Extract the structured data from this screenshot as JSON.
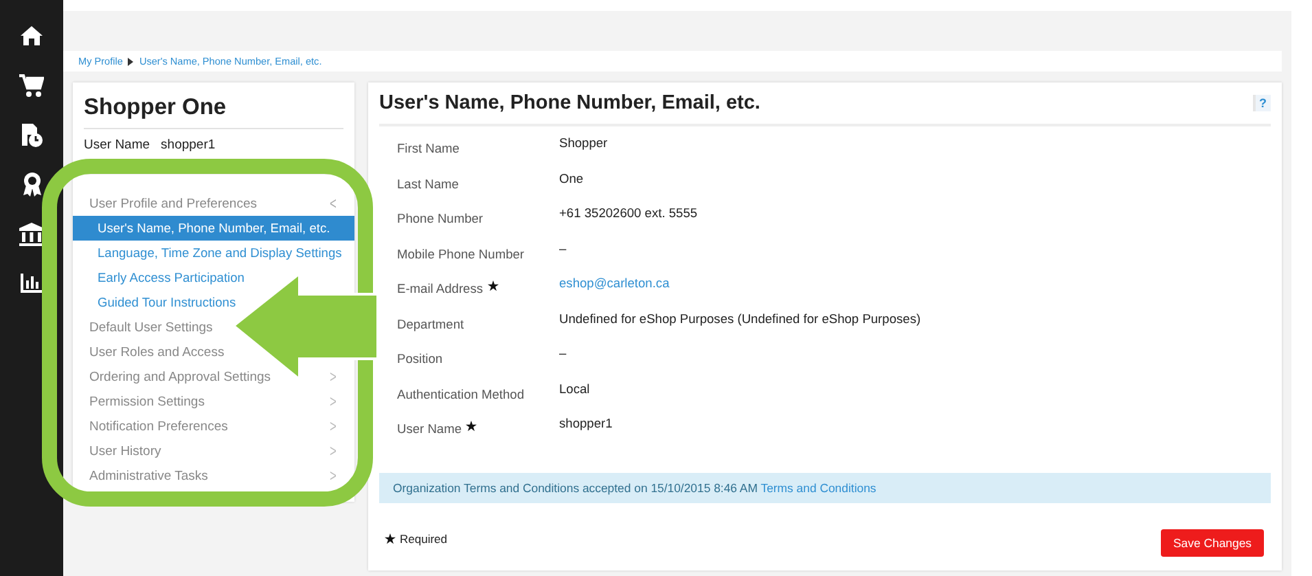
{
  "nav_rail": {
    "items": [
      {
        "kind": "home"
      },
      {
        "kind": "cart"
      },
      {
        "kind": "orders"
      },
      {
        "kind": "award"
      },
      {
        "kind": "bank"
      },
      {
        "kind": "chart"
      }
    ]
  },
  "breadcrumb": [
    {
      "label": "My Profile"
    },
    {
      "label": "User's Name, Phone Number, Email, etc."
    }
  ],
  "profile": {
    "name": "Shopper One",
    "user_name_label": "User Name",
    "user_name": "shopper1"
  },
  "menu": [
    {
      "label": "User Profile and Preferences",
      "kind": "group",
      "expanded": true,
      "chevron": "<",
      "children": [
        {
          "label": "User's Name, Phone Number, Email, etc.",
          "selected": true
        },
        {
          "label": "Language, Time Zone and Display Settings",
          "selected": false
        },
        {
          "label": "Early Access Participation",
          "selected": false
        },
        {
          "label": "Guided Tour Instructions",
          "selected": false
        }
      ]
    },
    {
      "label": "Default User Settings",
      "kind": "link"
    },
    {
      "label": "User Roles and Access",
      "kind": "link"
    },
    {
      "label": "Ordering and Approval Settings",
      "kind": "group",
      "expanded": false,
      "chevron": ">"
    },
    {
      "label": "Permission Settings",
      "kind": "group",
      "expanded": false,
      "chevron": ">"
    },
    {
      "label": "Notification Preferences",
      "kind": "group",
      "expanded": false,
      "chevron": ">"
    },
    {
      "label": "User History",
      "kind": "group",
      "expanded": false,
      "chevron": ">"
    },
    {
      "label": "Administrative Tasks",
      "kind": "group",
      "expanded": false,
      "chevron": ">"
    }
  ],
  "form": {
    "title": "User's Name, Phone Number, Email, etc.",
    "help": "?",
    "fields": [
      {
        "label": "First Name",
        "value": "Shopper",
        "required": false,
        "kind": "text"
      },
      {
        "label": "Last Name",
        "value": "One",
        "required": false,
        "kind": "text"
      },
      {
        "label": "Phone Number",
        "value": "+61 35202600 ext. 5555",
        "required": false,
        "kind": "text"
      },
      {
        "label": "Mobile Phone Number",
        "value": "–",
        "required": false,
        "kind": "text"
      },
      {
        "label": "E-mail Address",
        "value": "eshop@carleton.ca",
        "required": true,
        "kind": "link"
      },
      {
        "label": "Department",
        "value": "Undefined for eShop Purposes (Undefined for eShop Purposes)",
        "required": false,
        "kind": "text"
      },
      {
        "label": "Position",
        "value": "–",
        "required": false,
        "kind": "text"
      },
      {
        "label": "Authentication Method",
        "value": "Local",
        "required": false,
        "kind": "text"
      },
      {
        "label": "User Name",
        "value": "shopper1",
        "required": true,
        "kind": "text"
      }
    ],
    "notice": {
      "text": "Organization Terms and Conditions accepted on 15/10/2015 8:46 AM",
      "link": "Terms and Conditions"
    },
    "required_note": "Required",
    "save_button": "Save Changes"
  },
  "annotation": {
    "kind": "highlight-arrow"
  }
}
